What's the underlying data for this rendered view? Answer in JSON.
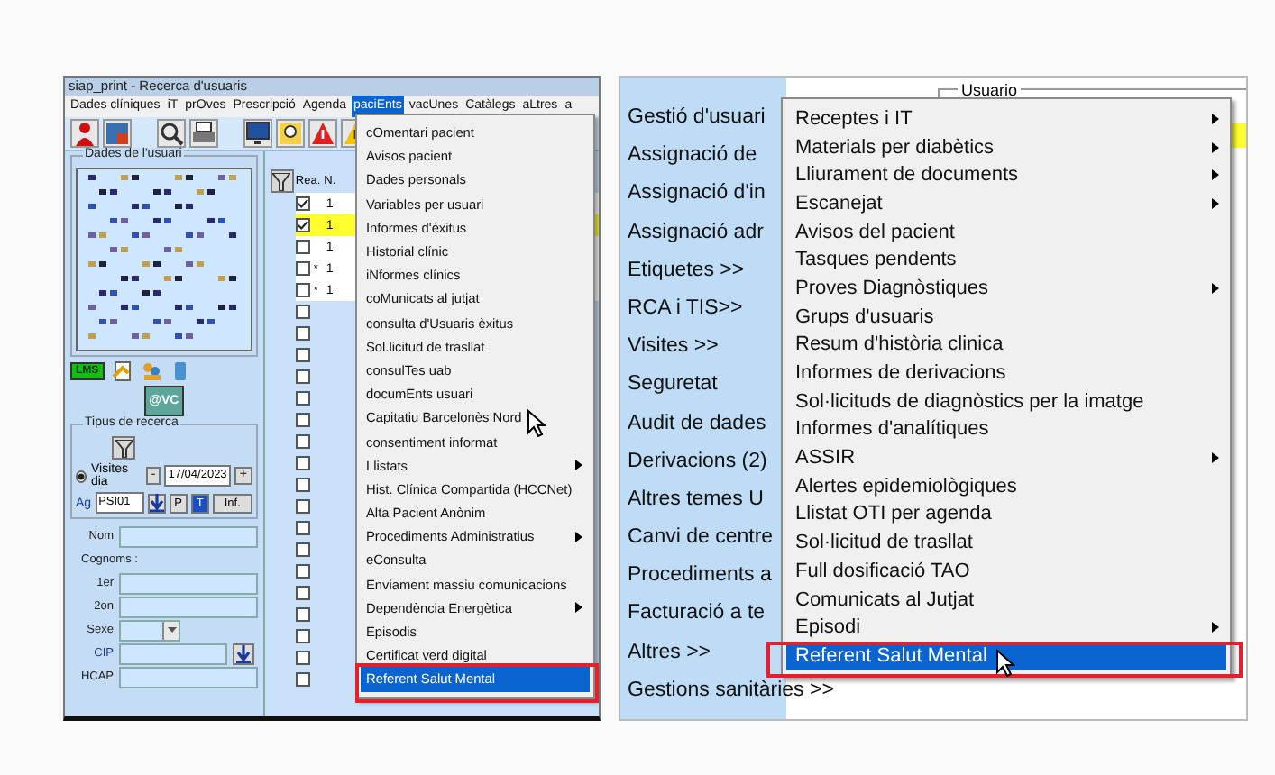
{
  "left_window": {
    "title": "siap_print - Recerca d'usuaris",
    "menu_bar": [
      {
        "label": "Dades clíniques",
        "selected": false
      },
      {
        "label": "iT",
        "selected": false
      },
      {
        "label": "prOves",
        "selected": false
      },
      {
        "label": "Prescripció",
        "selected": false
      },
      {
        "label": "Agenda",
        "selected": false
      },
      {
        "label": "paciEnts",
        "selected": true
      },
      {
        "label": "vacUnes",
        "selected": false
      },
      {
        "label": "Catàlegs",
        "selected": false
      },
      {
        "label": "aLtres",
        "selected": false
      },
      {
        "label": "a",
        "selected": false
      }
    ],
    "user_panel": {
      "legend": "Dades de l'usuari",
      "badge": "LMS",
      "vc_button": "@VC"
    },
    "search_panel": {
      "legend": "Tipus de recerca",
      "radio": {
        "label": "Visites dia",
        "selected": true
      },
      "minus": "-",
      "date": "17/04/2023",
      "plus": "+",
      "agenda_label": "Ag",
      "agenda": "PSI01",
      "buttons": [
        {
          "label": "P",
          "selected": false
        },
        {
          "label": "T",
          "selected": true
        },
        {
          "label": "Inf.",
          "selected": false
        }
      ],
      "fields": [
        {
          "label": "Nom",
          "kind": "text"
        },
        {
          "label": "Cognoms :",
          "kind": "heading"
        },
        {
          "label": "1er",
          "kind": "text"
        },
        {
          "label": "2on",
          "kind": "text"
        },
        {
          "label": "Sexe",
          "kind": "select"
        },
        {
          "label": "CIP",
          "kind": "lookup"
        },
        {
          "label": "HCAP",
          "kind": "text"
        }
      ]
    },
    "list": {
      "columns": [
        "Rea.",
        "N."
      ],
      "rows": [
        {
          "checked": true,
          "highlighted": false,
          "cell": "1"
        },
        {
          "checked": true,
          "highlighted": true,
          "cell": "1"
        },
        {
          "checked": false,
          "highlighted": false,
          "cell": "1"
        },
        {
          "checked": false,
          "highlighted": false,
          "marker": "*",
          "cell": "1"
        },
        {
          "checked": false,
          "highlighted": false,
          "marker": "*",
          "cell": "1"
        },
        {
          "checked": false,
          "highlighted": false
        },
        {
          "checked": false,
          "highlighted": false
        },
        {
          "checked": false,
          "highlighted": false
        },
        {
          "checked": false,
          "highlighted": false
        },
        {
          "checked": false,
          "highlighted": false
        },
        {
          "checked": false,
          "highlighted": false
        },
        {
          "checked": false,
          "highlighted": false
        },
        {
          "checked": false,
          "highlighted": false
        },
        {
          "checked": false,
          "highlighted": false
        },
        {
          "checked": false,
          "highlighted": false
        },
        {
          "checked": false,
          "highlighted": false
        },
        {
          "checked": false,
          "highlighted": false
        },
        {
          "checked": false,
          "highlighted": false
        },
        {
          "checked": false,
          "highlighted": false
        },
        {
          "checked": false,
          "highlighted": false
        },
        {
          "checked": false,
          "highlighted": false
        },
        {
          "checked": false,
          "highlighted": false
        },
        {
          "checked": false,
          "highlighted": false
        }
      ]
    },
    "menu": {
      "items": [
        {
          "label": "cOmentari pacient",
          "submenu": false,
          "selected": false,
          "annotated": false
        },
        {
          "label": "Avisos pacient",
          "submenu": false,
          "selected": false,
          "annotated": false
        },
        {
          "label": "Dades personals",
          "submenu": false,
          "selected": false,
          "annotated": false
        },
        {
          "label": "Variables per usuari",
          "submenu": false,
          "selected": false,
          "annotated": false
        },
        {
          "label": "Informes d'èxitus",
          "submenu": false,
          "selected": false,
          "annotated": false
        },
        {
          "label": "Historial clínic",
          "submenu": false,
          "selected": false,
          "annotated": false
        },
        {
          "label": "iNformes clínics",
          "submenu": false,
          "selected": false,
          "annotated": false
        },
        {
          "label": "coMunicats al jutjat",
          "submenu": false,
          "selected": false,
          "annotated": false
        },
        {
          "label": "consulta d'Usuaris èxitus",
          "submenu": false,
          "selected": false,
          "annotated": false
        },
        {
          "label": "Sol.licitud de trasllat",
          "submenu": false,
          "selected": false,
          "annotated": false
        },
        {
          "label": "consulTes uab",
          "submenu": false,
          "selected": false,
          "annotated": false
        },
        {
          "label": "documEnts usuari",
          "submenu": false,
          "selected": false,
          "annotated": false
        },
        {
          "label": "Capitatiu Barcelonès Nord",
          "submenu": false,
          "selected": false,
          "annotated": false,
          "pointer": true
        },
        {
          "label": "consentiment informat",
          "submenu": false,
          "selected": false,
          "annotated": false
        },
        {
          "label": "Llistats",
          "submenu": true,
          "selected": false,
          "annotated": false
        },
        {
          "label": "Hist. Clínica Compartida (HCCNet)",
          "submenu": false,
          "selected": false,
          "annotated": false
        },
        {
          "label": "Alta Pacient Anònim",
          "submenu": false,
          "selected": false,
          "annotated": false
        },
        {
          "label": "Procediments Administratius",
          "submenu": true,
          "selected": false,
          "annotated": false
        },
        {
          "label": "eConsulta",
          "submenu": false,
          "selected": false,
          "annotated": false
        },
        {
          "label": "Enviament massiu comunicacions",
          "submenu": false,
          "selected": false,
          "annotated": false
        },
        {
          "label": "Dependència Energètica",
          "submenu": true,
          "selected": false,
          "annotated": false
        },
        {
          "label": "Episodis",
          "submenu": false,
          "selected": false,
          "annotated": false
        },
        {
          "label": "Certificat verd digital",
          "submenu": false,
          "selected": false,
          "annotated": false
        },
        {
          "label": "Referent Salut Mental",
          "submenu": false,
          "selected": true,
          "annotated": true
        }
      ]
    }
  },
  "right_window": {
    "nav": [
      "Gestió d'usuari",
      "Assignació de",
      "Assignació d'in",
      "Assignació adr",
      "Etiquetes >>",
      "RCA i TIS>>",
      "Visites >>",
      "Seguretat",
      "Audit de dades",
      "Derivacions (2)",
      "Altres temes U",
      "Canvi de centre",
      "Procediments a",
      "Facturació a te",
      "Altres >>",
      "Gestions sanitàries >>"
    ],
    "panel_legend": "Usuario",
    "menu": {
      "items": [
        {
          "label": "Receptes i IT",
          "submenu": true,
          "selected": false,
          "annotated": false
        },
        {
          "label": "Materials per diabètics",
          "submenu": true,
          "selected": false,
          "annotated": false
        },
        {
          "label": "Lliurament de documents",
          "submenu": true,
          "selected": false,
          "annotated": false
        },
        {
          "label": "Escanejat",
          "submenu": true,
          "selected": false,
          "annotated": false
        },
        {
          "label": "Avisos del pacient",
          "submenu": false,
          "selected": false,
          "annotated": false
        },
        {
          "label": "Tasques pendents",
          "submenu": false,
          "selected": false,
          "annotated": false
        },
        {
          "label": "Proves Diagnòstiques",
          "submenu": true,
          "selected": false,
          "annotated": false
        },
        {
          "label": "Grups d'usuaris",
          "submenu": false,
          "selected": false,
          "annotated": false
        },
        {
          "label": "Resum d'història clinica",
          "submenu": false,
          "selected": false,
          "annotated": false
        },
        {
          "label": "Informes de derivacions",
          "submenu": false,
          "selected": false,
          "annotated": false
        },
        {
          "label": "Sol·licituds de diagnòstics per la imatge",
          "submenu": false,
          "selected": false,
          "annotated": false
        },
        {
          "label": "Informes d'analítiques",
          "submenu": false,
          "selected": false,
          "annotated": false
        },
        {
          "label": "ASSIR",
          "submenu": true,
          "selected": false,
          "annotated": false
        },
        {
          "label": "Alertes epidemiològiques",
          "submenu": false,
          "selected": false,
          "annotated": false
        },
        {
          "label": "Llistat OTI per agenda",
          "submenu": false,
          "selected": false,
          "annotated": false
        },
        {
          "label": "Sol·licitud de trasllat",
          "submenu": false,
          "selected": false,
          "annotated": false
        },
        {
          "label": "Full dosificació TAO",
          "submenu": false,
          "selected": false,
          "annotated": false
        },
        {
          "label": "Comunicats al Jutjat",
          "submenu": false,
          "selected": false,
          "annotated": false
        },
        {
          "label": "Episodi",
          "submenu": true,
          "selected": false,
          "annotated": false
        },
        {
          "label": "Referent Salut Mental",
          "submenu": false,
          "selected": true,
          "annotated": true,
          "pointer": true
        }
      ]
    }
  }
}
